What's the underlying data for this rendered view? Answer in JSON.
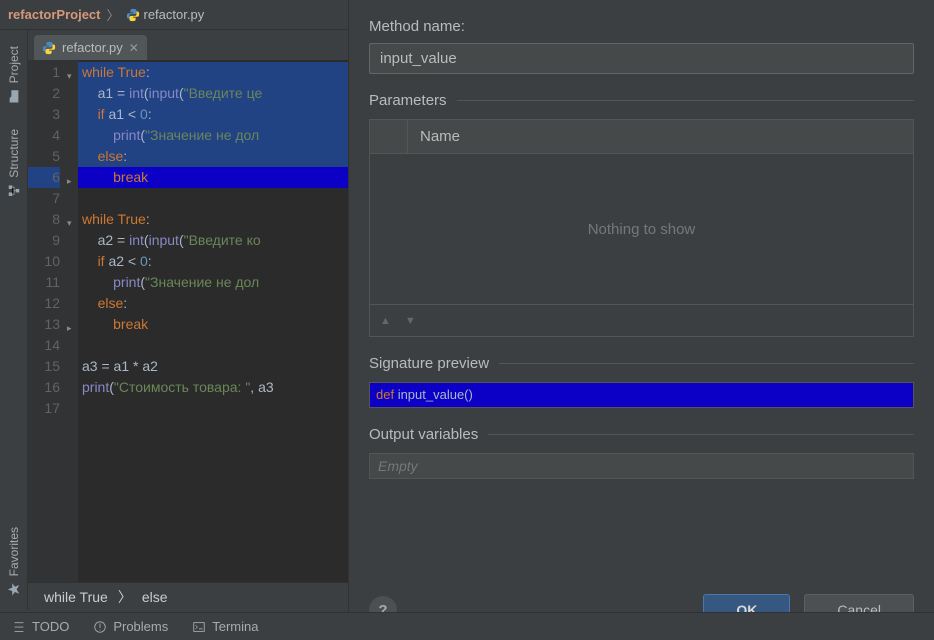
{
  "breadcrumb": {
    "project": "refactorProject",
    "file": "refactor.py"
  },
  "left_rail": {
    "project": "Project",
    "structure": "Structure",
    "favorites": "Favorites"
  },
  "tabs": [
    {
      "label": "refactor.py"
    }
  ],
  "code": {
    "lines": [
      {
        "n": 1,
        "sel": true,
        "fold": "▾",
        "html": "<span class='kw'>while</span> <span class='kw'>True</span><span class='op'>:</span>"
      },
      {
        "n": 2,
        "sel": true,
        "html": "    <span class='id'>a1</span> <span class='op'>=</span> <span class='fn'>int</span><span class='op'>(</span><span class='fn'>input</span><span class='op'>(</span><span class='str'>\"Введите це</span>"
      },
      {
        "n": 3,
        "sel": true,
        "html": "    <span class='kw'>if</span> <span class='id'>a1</span> <span class='op'>&lt;</span> <span class='num'>0</span><span class='op'>:</span>"
      },
      {
        "n": 4,
        "sel": true,
        "html": "        <span class='fn'>print</span><span class='op'>(</span><span class='str'>\"Значение не дол</span>"
      },
      {
        "n": 5,
        "sel": true,
        "html": "    <span class='kw'>else</span><span class='op'>:</span>"
      },
      {
        "n": 6,
        "sel": true,
        "hl": true,
        "fold": "▸",
        "html": "        <span class='kw'>break</span>"
      },
      {
        "n": 7,
        "html": ""
      },
      {
        "n": 8,
        "fold": "▾",
        "html": "<span class='kw'>while</span> <span class='kw'>True</span><span class='op'>:</span>"
      },
      {
        "n": 9,
        "html": "    <span class='id'>a2</span> <span class='op'>=</span> <span class='fn'>int</span><span class='op'>(</span><span class='fn'>input</span><span class='op'>(</span><span class='str'>\"Введите ко</span>"
      },
      {
        "n": 10,
        "html": "    <span class='kw'>if</span> <span class='id'>a2</span> <span class='op'>&lt;</span> <span class='num'>0</span><span class='op'>:</span>"
      },
      {
        "n": 11,
        "html": "        <span class='fn'>print</span><span class='op'>(</span><span class='str'>\"Значение не дол</span>"
      },
      {
        "n": 12,
        "html": "    <span class='kw'>else</span><span class='op'>:</span>"
      },
      {
        "n": 13,
        "fold": "▸",
        "html": "        <span class='kw'>break</span>"
      },
      {
        "n": 14,
        "html": ""
      },
      {
        "n": 15,
        "html": "<span class='id'>a3</span> <span class='op'>=</span> <span class='id'>a1</span> <span class='op'>*</span> <span class='id'>a2</span>"
      },
      {
        "n": 16,
        "html": "<span class='fn'>print</span><span class='op'>(</span><span class='str'>\"Стоимость товара: \"</span><span class='op'>,</span> <span class='id'>a3</span>"
      },
      {
        "n": 17,
        "html": ""
      }
    ]
  },
  "editor_breadcrumb": {
    "a": "while True",
    "b": "else"
  },
  "dialog": {
    "method_name_label": "Method name:",
    "method_name_value": "input_value",
    "parameters_label": "Parameters",
    "name_col": "Name",
    "nothing": "Nothing to show",
    "sig_label": "Signature preview",
    "sig_def": "def ",
    "sig_rest": "input_value()",
    "output_label": "Output variables",
    "output_value": "Empty",
    "ok": "OK",
    "cancel": "Cancel"
  },
  "bottom": {
    "todo": "TODO",
    "problems": "Problems",
    "terminal": "Termina"
  }
}
